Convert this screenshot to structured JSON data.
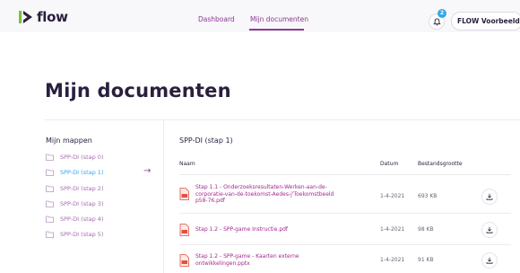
{
  "header": {
    "logo_text": "flow",
    "nav": [
      {
        "label": "Dashboard"
      },
      {
        "label": "Mijn documenten"
      }
    ],
    "notification_count": "2",
    "user_label": "FLOW Voorbeeld"
  },
  "page": {
    "title": "Mijn documenten"
  },
  "sidebar": {
    "title": "Mijn mappen",
    "folders": [
      {
        "label": "SPP-DI (stap 0)"
      },
      {
        "label": "SPP-DI (stap 1)"
      },
      {
        "label": "SPP-DI (stap 2)"
      },
      {
        "label": "SPP-DI (stap 3)"
      },
      {
        "label": "SPP-DI (stap 4)"
      },
      {
        "label": "SPP-DI (stap 5)"
      }
    ],
    "active_arrow": "→"
  },
  "main": {
    "folder_title": "SPP-DI (stap 1)",
    "columns": {
      "name": "Naam",
      "date": "Datum",
      "size": "Bestandsgrootte"
    },
    "documents": [
      {
        "name_lines": [
          "Stap 1.1 - Onderzoeksresultaten-Werken-aan-de-",
          "corporatie-van-de-toekomst-Aedes-j'Toekomstbeeld",
          "p58-76.pdf"
        ],
        "date": "1-4-2021",
        "size": "693 KB"
      },
      {
        "name_lines": [
          "Stap 1.2 - SPP-game Instructie.pdf"
        ],
        "date": "1-4-2021",
        "size": "98 KB"
      },
      {
        "name_lines": [
          "Stap 1.2 - SPP-game - Kaarten externe",
          "ontwikkelingen.pptx"
        ],
        "date": "1-4-2021",
        "size": "91 KB"
      }
    ]
  },
  "colors": {
    "primary_purple": "#8a3a97",
    "doc_link": "#a4288f",
    "accent_blue": "#35a8e8",
    "logo_green": "#7bc142",
    "pdf_red": "#e0523f"
  }
}
